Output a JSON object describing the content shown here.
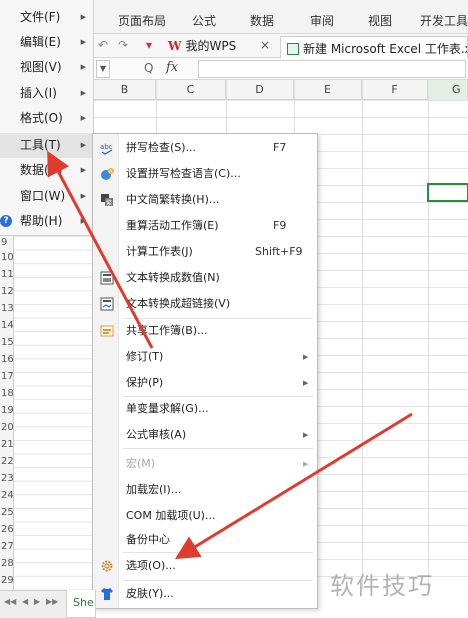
{
  "ribbon": {
    "tabs": [
      "页面布局",
      "公式",
      "数据",
      "审阅",
      "视图",
      "开发工具"
    ]
  },
  "doc_tabs": {
    "wps_tab": "我的WPS",
    "wps_logo": "W",
    "close_glyph": "×",
    "file_tab": "新建 Microsoft Excel 工作表.xlsx"
  },
  "formula_bar": {
    "zoom_glyph": "Q",
    "fx_label": "fx"
  },
  "grid": {
    "column_headers": [
      "B",
      "C",
      "D",
      "E",
      "F",
      "G"
    ],
    "row_headers": [
      "9",
      "10",
      "11",
      "12",
      "13",
      "14",
      "15",
      "16",
      "17",
      "18",
      "19",
      "20",
      "21",
      "22",
      "23",
      "24",
      "25",
      "26",
      "27",
      "28",
      "29"
    ]
  },
  "main_menu": {
    "items": [
      {
        "label": "文件(F)",
        "has_submenu": true
      },
      {
        "label": "编辑(E)",
        "has_submenu": true
      },
      {
        "label": "视图(V)",
        "has_submenu": true
      },
      {
        "label": "插入(I)",
        "has_submenu": true
      },
      {
        "label": "格式(O)",
        "has_submenu": true
      },
      {
        "label": "工具(T)",
        "has_submenu": true,
        "active": true
      },
      {
        "label": "数据(D)",
        "has_submenu": true
      },
      {
        "label": "窗口(W)",
        "has_submenu": true
      },
      {
        "label": "帮助(H)",
        "has_submenu": true
      }
    ]
  },
  "tools_menu": {
    "items": [
      {
        "label": "拼写检查(S)...",
        "shortcut": "F7",
        "icon": "spellcheck-icon"
      },
      {
        "label": "设置拼写检查语言(C)...",
        "shortcut": "",
        "icon": "language-icon"
      },
      {
        "label": "中文简繁转换(H)...",
        "shortcut": "",
        "icon": "chinese-convert-icon"
      },
      {
        "label": "重算活动工作簿(E)",
        "shortcut": "F9",
        "icon": ""
      },
      {
        "label": "计算工作表(J)",
        "shortcut": "Shift+F9",
        "icon": ""
      },
      {
        "label": "文本转换成数值(N)",
        "shortcut": "",
        "icon": "text-to-number-icon"
      },
      {
        "label": "文本转换成超链接(V)",
        "shortcut": "",
        "icon": "text-to-hyperlink-icon"
      },
      {
        "label": "共享工作簿(B)...",
        "shortcut": "",
        "icon": "share-workbook-icon"
      },
      {
        "label": "修订(T)",
        "shortcut": "",
        "icon": "",
        "submenu": true
      },
      {
        "label": "保护(P)",
        "shortcut": "",
        "icon": "",
        "submenu": true
      },
      {
        "label": "单变量求解(G)...",
        "shortcut": "",
        "icon": ""
      },
      {
        "label": "公式审核(A)",
        "shortcut": "",
        "icon": "",
        "submenu": true
      },
      {
        "label": "宏(M)",
        "shortcut": "",
        "icon": "",
        "submenu": true,
        "disabled": true
      },
      {
        "label": "加载宏(I)...",
        "shortcut": "",
        "icon": ""
      },
      {
        "label": "COM 加载项(U)...",
        "shortcut": "",
        "icon": ""
      },
      {
        "label": "备份中心",
        "shortcut": "",
        "icon": ""
      },
      {
        "label": "选项(O)...",
        "shortcut": "",
        "icon": "gear-icon"
      },
      {
        "label": "皮肤(Y)...",
        "shortcut": "",
        "icon": "skin-shirt-icon"
      }
    ]
  },
  "sheet_bar": {
    "tab_label": "She"
  },
  "watermark": "软件技巧",
  "colors": {
    "annotation_arrow": "#e03b2f",
    "active_cell_border": "#2e8b3d",
    "menu_background": "#f6f6f6"
  }
}
